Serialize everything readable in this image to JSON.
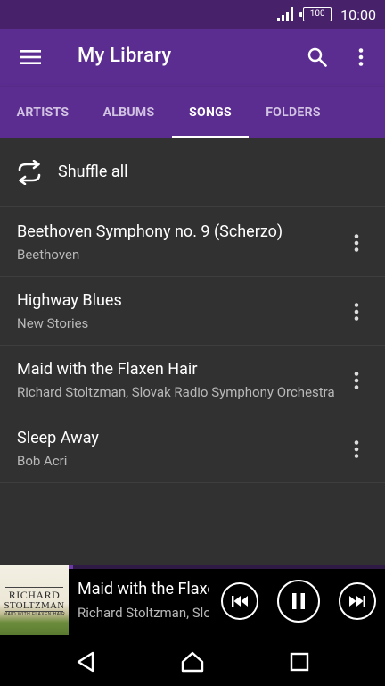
{
  "status_bar": {
    "battery": "100",
    "time": "10:00",
    "icons": [
      "signal-icon",
      "battery-icon"
    ]
  },
  "app_bar": {
    "title": "My Library",
    "icons": [
      "menu-icon",
      "search-icon",
      "more-vert-icon"
    ]
  },
  "tabs": [
    {
      "label": "ARTISTS",
      "active": false
    },
    {
      "label": "ALBUMS",
      "active": false
    },
    {
      "label": "SONGS",
      "active": true
    },
    {
      "label": "FOLDERS",
      "active": false
    }
  ],
  "shuffle": {
    "label": "Shuffle all",
    "icon": "shuffle-icon"
  },
  "songs": [
    {
      "title": "Beethoven Symphony no. 9 (Scherzo)",
      "artist": "Beethoven"
    },
    {
      "title": "Highway Blues",
      "artist": "New Stories"
    },
    {
      "title": "Maid with the Flaxen Hair",
      "artist": "Richard Stoltzman, Slovak Radio Symphony Orchestra"
    },
    {
      "title": "Sleep Away",
      "artist": "Bob Acri"
    }
  ],
  "now_playing": {
    "title": "Maid with the Flaxen Hair",
    "artist": "Richard Stoltzman, Slovak Radio Symphony Orchestra",
    "progress": 0.19,
    "album_art_text": {
      "line1": "RICHARD",
      "line2": "STOLTZMAN",
      "line3": "MAID WITH FLAXEN HAIR"
    },
    "controls": [
      "previous-icon",
      "pause-icon",
      "next-icon"
    ]
  },
  "nav_bar": {
    "icons": [
      "back-icon",
      "home-icon",
      "recents-icon"
    ]
  },
  "colors": {
    "status_bar": "#47216a",
    "app_bar": "#5c2d91",
    "content_bg": "#313131",
    "tab_inactive": "#d2c3e3",
    "secondary_text": "#b8b8b8"
  }
}
